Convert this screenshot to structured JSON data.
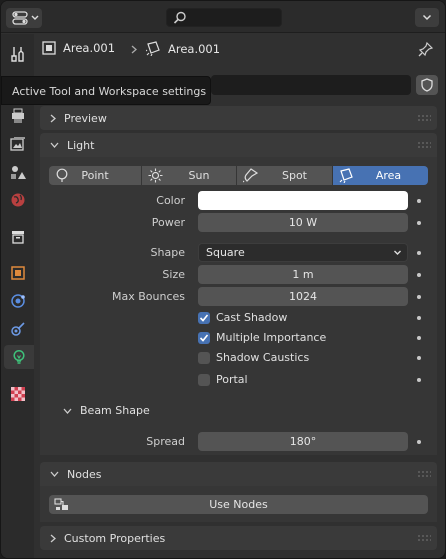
{
  "header": {
    "editor_icon": "properties-editor-icon",
    "search_icon": "search-icon"
  },
  "context": {
    "object_name": "Area.001",
    "light_name": "Area.001"
  },
  "tooltip": "Active Tool and Workspace settings",
  "panels": {
    "preview": "Preview",
    "light": "Light",
    "beam_shape": "Beam Shape",
    "nodes": "Nodes",
    "custom_properties": "Custom Properties"
  },
  "light_types": {
    "point": "Point",
    "sun": "Sun",
    "spot": "Spot",
    "area": "Area",
    "selected": "Area"
  },
  "labels": {
    "color": "Color",
    "power": "Power",
    "shape": "Shape",
    "size": "Size",
    "max_bounces": "Max Bounces",
    "spread": "Spread"
  },
  "values": {
    "color": "#ffffff",
    "power": "10 W",
    "shape": "Square",
    "size": "1 m",
    "max_bounces": "1024",
    "spread": "180°"
  },
  "checkboxes": {
    "cast_shadow": {
      "label": "Cast Shadow",
      "checked": true
    },
    "multiple_importance": {
      "label": "Multiple Importance",
      "checked": true
    },
    "shadow_caustics": {
      "label": "Shadow Caustics",
      "checked": false
    },
    "portal": {
      "label": "Portal",
      "checked": false
    }
  },
  "buttons": {
    "use_nodes": "Use Nodes"
  },
  "colors": {
    "accent": "#4772b3",
    "panel": "#3a3a3a",
    "field": "#545454"
  }
}
